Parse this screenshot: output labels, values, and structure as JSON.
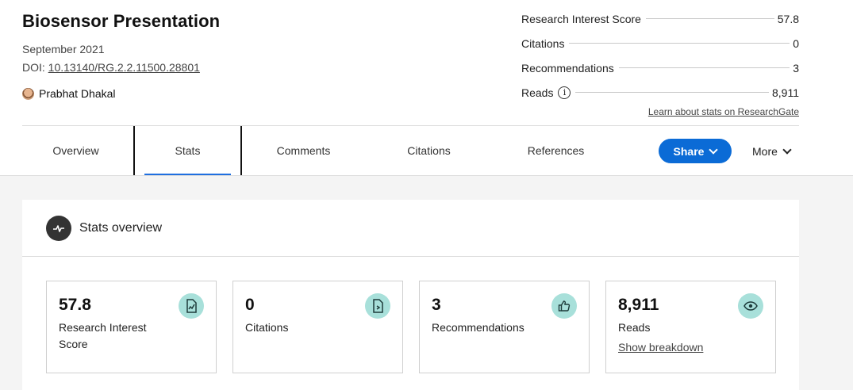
{
  "publication": {
    "title": "Biosensor Presentation",
    "date": "September 2021",
    "doi_prefix": "DOI: ",
    "doi": "10.13140/RG.2.2.11500.28801",
    "author": "Prabhat Dhakal"
  },
  "stats": [
    {
      "label": "Research Interest Score",
      "value": "57.8"
    },
    {
      "label": "Citations",
      "value": "0"
    },
    {
      "label": "Recommendations",
      "value": "3"
    },
    {
      "label": "Reads",
      "value": "8,911"
    }
  ],
  "learn_link": "Learn about stats on ResearchGate",
  "tabs": [
    {
      "label": "Overview"
    },
    {
      "label": "Stats"
    },
    {
      "label": "Comments"
    },
    {
      "label": "Citations"
    },
    {
      "label": "References"
    }
  ],
  "share_label": "Share",
  "more_label": "More",
  "overview": {
    "title": "Stats overview",
    "cards": [
      {
        "value": "57.8",
        "caption": "Research Interest Score",
        "icon": "research-score-icon"
      },
      {
        "value": "0",
        "caption": "Citations",
        "icon": "citation-document-icon"
      },
      {
        "value": "3",
        "caption": "Recommendations",
        "icon": "thumbs-up-icon"
      },
      {
        "value": "8,911",
        "caption": "Reads",
        "icon": "eye-icon",
        "link": "Show breakdown"
      }
    ]
  },
  "colors": {
    "accent": "#0b6bd6",
    "badge": "#a8e0da",
    "panel_bg": "#f4f4f4"
  }
}
